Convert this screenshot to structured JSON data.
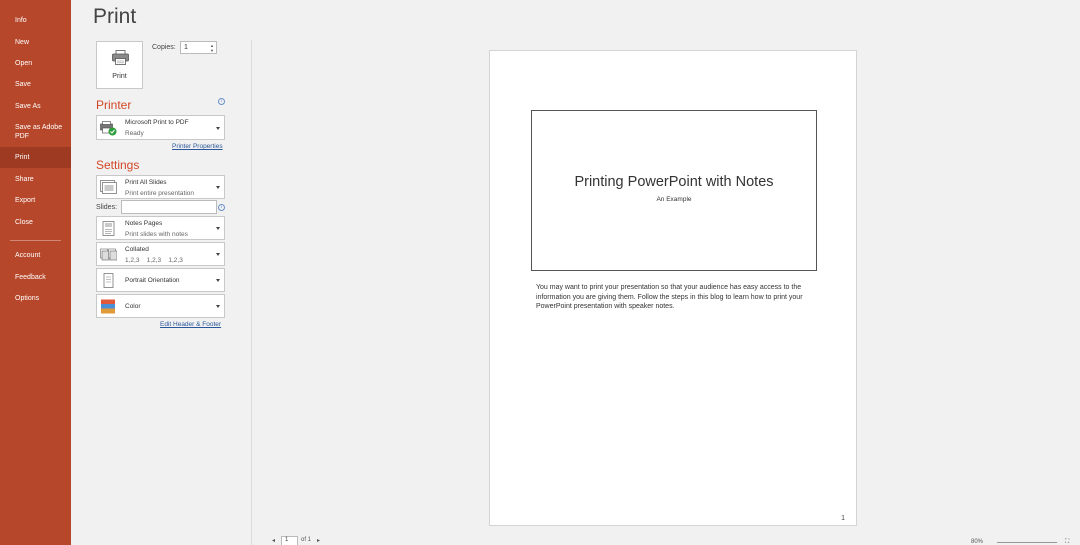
{
  "sidebar": {
    "items": [
      {
        "label": "Info"
      },
      {
        "label": "New"
      },
      {
        "label": "Open"
      },
      {
        "label": "Save"
      },
      {
        "label": "Save As"
      },
      {
        "label": "Save as Adobe PDF"
      },
      {
        "label": "Print",
        "active": true
      },
      {
        "label": "Share"
      },
      {
        "label": "Export"
      },
      {
        "label": "Close"
      },
      {
        "label": "Account"
      },
      {
        "label": "Feedback"
      },
      {
        "label": "Options"
      }
    ]
  },
  "page_title": "Print",
  "print_button": {
    "label": "Print",
    "icon": "printer-icon"
  },
  "copies": {
    "label": "Copies:",
    "value": "1"
  },
  "printer": {
    "heading": "Printer",
    "name": "Microsoft Print to PDF",
    "status": "Ready",
    "properties_link": "Printer Properties"
  },
  "settings": {
    "heading": "Settings",
    "slides_range": {
      "title": "Print All Slides",
      "subtitle": "Print entire presentation"
    },
    "slides_label": "Slides:",
    "slides_value": "",
    "layout": {
      "title": "Notes Pages",
      "subtitle": "Print slides with notes"
    },
    "collation": {
      "title": "Collated",
      "subtitle": "1,2,3    1,2,3    1,2,3"
    },
    "orientation": {
      "title": "Portrait Orientation"
    },
    "color": {
      "title": "Color"
    },
    "header_footer_link": "Edit Header & Footer"
  },
  "preview": {
    "slide_title": "Printing PowerPoint with Notes",
    "slide_subtitle": "An Example",
    "notes": "You may want to print your presentation so that your audience has easy access to the information you are giving them. Follow  the steps in this blog to learn how to print your PowerPoint presentation with speaker notes.",
    "page_number": "1"
  },
  "pager": {
    "current": "1",
    "total": "of 1"
  },
  "zoom": {
    "level": "80%"
  },
  "colors": {
    "sidebar": "#b7472a",
    "accent": "#d24726",
    "link": "#2b579a"
  }
}
